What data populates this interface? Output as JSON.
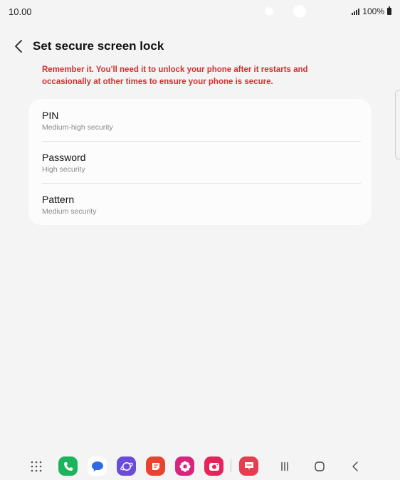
{
  "status_bar": {
    "time": "10.00",
    "battery": "100%"
  },
  "header": {
    "title": "Set secure screen lock"
  },
  "warning": "Remember it. You'll need it to unlock your phone after it restarts and occasionally at other times to ensure your phone is secure.",
  "lock_options": [
    {
      "title": "PIN",
      "subtitle": "Medium-high security"
    },
    {
      "title": "Password",
      "subtitle": "High security"
    },
    {
      "title": "Pattern",
      "subtitle": "Medium security"
    }
  ],
  "colors": {
    "warning": "#d3302f",
    "background": "#f4f4f4",
    "card": "#fcfcfc"
  },
  "nav_bar": {
    "apps": [
      {
        "name": "app-drawer-icon"
      },
      {
        "name": "phone-app-icon",
        "color": "#1db35d"
      },
      {
        "name": "messages-app-icon",
        "color": "#ffffff"
      },
      {
        "name": "internet-app-icon",
        "color": "#6a4cdb"
      },
      {
        "name": "notes-app-icon",
        "color": "#e8432f"
      },
      {
        "name": "gallery-app-icon",
        "color": "#d8247a"
      },
      {
        "name": "camera-app-icon",
        "color": "#e5245a"
      },
      {
        "name": "chat-app-icon",
        "color": "#ea3b4f"
      }
    ]
  }
}
